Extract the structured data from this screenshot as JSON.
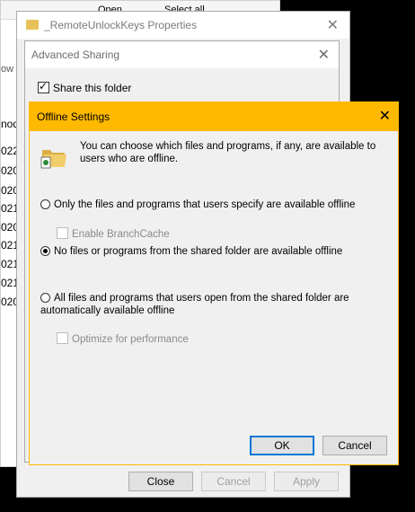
{
  "explorer": {
    "ribbon_open": "Open",
    "ribbon_select_all": "Select all",
    "nav_label": "ow",
    "column_header": "nod",
    "rows": [
      "022",
      "020",
      "020",
      "021",
      "020",
      "021",
      "021",
      "021",
      "020",
      "021"
    ]
  },
  "properties": {
    "title": "_RemoteUnlockKeys Properties",
    "close_label": "Close",
    "cancel_label": "Cancel",
    "apply_label": "Apply"
  },
  "advanced": {
    "title": "Advanced Sharing",
    "share_label": "Share this folder",
    "share_checked": true
  },
  "offline": {
    "title": "Offline Settings",
    "info_text": "You can choose which files and programs, if any, are available to users who are offline.",
    "option1": "Only the files and programs that users specify are available offline",
    "branchcache": "Enable BranchCache",
    "option2": "No files or programs from the shared folder are available offline",
    "option3": "All files and programs that users open from the shared folder are automatically available offline",
    "optimize": "Optimize for performance",
    "selected_option": 2,
    "ok_label": "OK",
    "cancel_label": "Cancel",
    "accent_color": "#ffb900"
  }
}
